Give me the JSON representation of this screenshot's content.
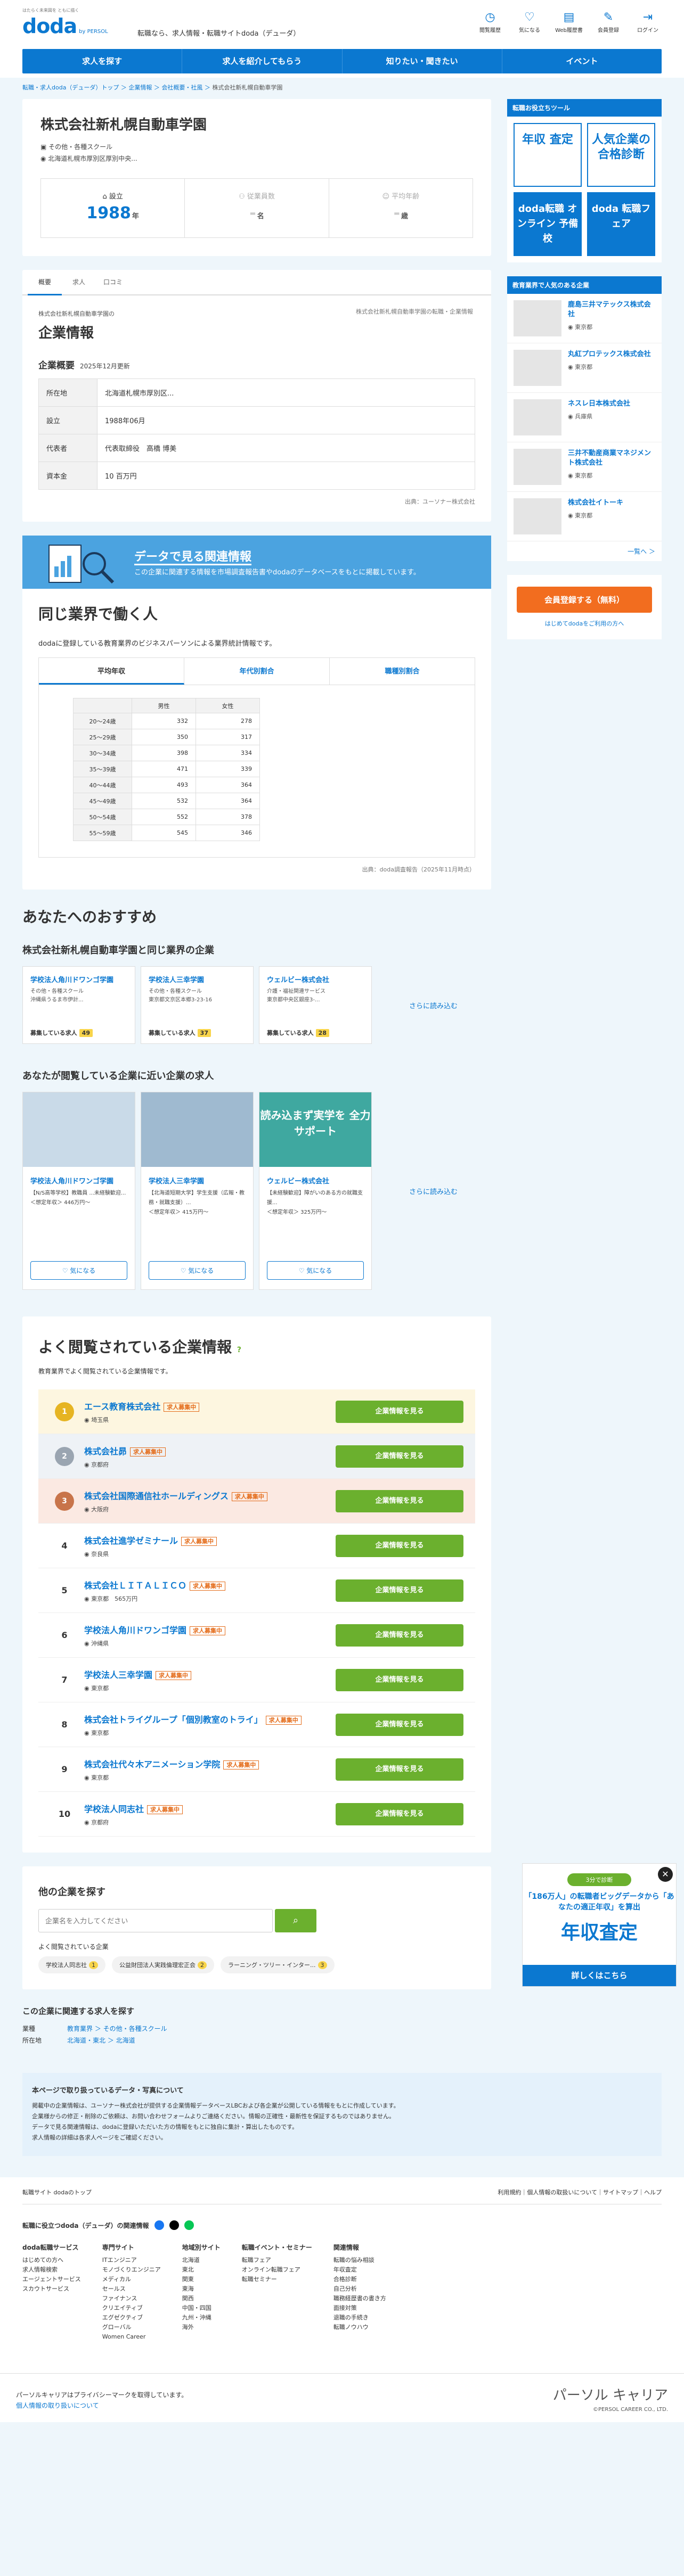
{
  "header": {
    "logo_small": "はたらく未来図を ともに描く",
    "logo_main": "doda",
    "logo_sub": "by PERSOL",
    "tagline": "転職なら、求人情報・転職サイトdoda（デューダ）",
    "icons": [
      {
        "label": "閲覧履歴",
        "icon": "clock-icon",
        "glyph": "◷"
      },
      {
        "label": "気になる",
        "icon": "heart-icon",
        "glyph": "♡"
      },
      {
        "label": "Web履歴書",
        "icon": "document-icon",
        "glyph": "▤"
      },
      {
        "label": "会員登録",
        "icon": "pencil-icon",
        "glyph": "✎"
      },
      {
        "label": "ログイン",
        "icon": "login-icon",
        "glyph": "⇥"
      }
    ]
  },
  "nav": [
    "求人を探す",
    "求人を紹介してもらう",
    "知りたい・聞きたい",
    "イベント"
  ],
  "breadcrumb": {
    "items": [
      "転職・求人doda（デューダ）トップ",
      "企業情報",
      "会社概要・社風"
    ],
    "current": "株式会社新札幌自動車学園"
  },
  "company": {
    "name": "株式会社新札幌自動車学園",
    "industry": "その他・各種スクール",
    "address": "北海道札幌市厚別区厚別中央...",
    "stats": [
      {
        "label": "設立",
        "value": "1988",
        "unit": "年",
        "dim": false
      },
      {
        "label": "従業員数",
        "value": "-",
        "unit": "名",
        "dim": true
      },
      {
        "label": "平均年齢",
        "value": "-",
        "unit": "歳",
        "dim": true
      }
    ]
  },
  "tabs": [
    "概要",
    "求人",
    "口コミ"
  ],
  "info": {
    "source_note": "株式会社新札幌自動車学園の転職・企業情報",
    "kana": "株式会社新札幌自動車学園の",
    "title": "企業情報",
    "section": "企業概要",
    "updated": "2025年12月更新",
    "rows": [
      {
        "th": "所在地",
        "td": "北海道札幌市厚別区..."
      },
      {
        "th": "設立",
        "td": "1988年06月"
      },
      {
        "th": "代表者",
        "td": "代表取締役　高橋 博美"
      },
      {
        "th": "資本金",
        "td": "10 百万円"
      }
    ],
    "footer": "出典：ユーソナー株式会社"
  },
  "data_banner": {
    "title": "データで見る関連情報",
    "sub": "この企業に関連する情報を市場調査報告書やdodaのデータベースをもとに掲載しています。"
  },
  "same_industry": {
    "title": "同じ業界で働く人",
    "desc": "dodaに登録している教育業界のビジネスパーソンによる業界統計情報です。",
    "tabs": [
      "平均年収",
      "年代別割合",
      "職種別割合"
    ],
    "table": {
      "headers": [
        "男性",
        "女性"
      ],
      "rows": [
        {
          "age": "20〜24歳",
          "m": "332",
          "f": "278"
        },
        {
          "age": "25〜29歳",
          "m": "350",
          "f": "317"
        },
        {
          "age": "30〜34歳",
          "m": "398",
          "f": "334"
        },
        {
          "age": "35〜39歳",
          "m": "471",
          "f": "339"
        },
        {
          "age": "40〜44歳",
          "m": "493",
          "f": "364"
        },
        {
          "age": "45〜49歳",
          "m": "532",
          "f": "364"
        },
        {
          "age": "50〜54歳",
          "m": "552",
          "f": "378"
        },
        {
          "age": "55〜59歳",
          "m": "545",
          "f": "346"
        }
      ]
    },
    "footer": "出典：doda調査報告（2025年11月時点）"
  },
  "recommend": {
    "title": "あなたへのおすすめ",
    "same_title": "株式会社新札幌自動車学園と同じ業界の企業",
    "companies": [
      {
        "name": "学校法人角川ドワンゴ学園",
        "cat": "その他・各種スクール",
        "addr": "沖縄県うるま市伊計...",
        "badge": "募集している求人",
        "count": "49"
      },
      {
        "name": "学校法人三幸学園",
        "cat": "その他・各種スクール",
        "addr": "東京都文京区本郷3-23-16",
        "badge": "募集している求人",
        "count": "37"
      },
      {
        "name": "ウェルビー株式会社",
        "cat": "介護・福祉関連サービス",
        "addr": "東京都中央区銀座3-...",
        "badge": "募集している求人",
        "count": "28"
      }
    ],
    "more": "さらに読み込む",
    "viewed_title": "あなたが閲覧している企業に近い企業の求人",
    "jobs": [
      {
        "name": "学校法人角川ドワンゴ学園",
        "desc": "【N/S高等学校】教職員 ...未経験歓迎...",
        "salary": "＜想定年収＞ 446万円〜",
        "art": ""
      },
      {
        "name": "学校法人三幸学園",
        "desc": "【北海道短期大学】学生支援（広報・教務・就職支援）...",
        "salary": "＜想定年収＞ 415万円〜",
        "art": ""
      },
      {
        "name": "ウェルビー株式会社",
        "desc": "【未経験歓迎】障がいのある方の就職支援...",
        "salary": "＜想定年収＞ 325万円〜",
        "art": "読み込まず実学を 全力 サポート"
      }
    ],
    "fav_label": "気になる"
  },
  "popular": {
    "title": "よく閲覧されている企業情報",
    "desc": "教育業界でよく閲覧されている企業情報です。",
    "badge": "求人募集中",
    "btn": "企業情報を見る",
    "rows": [
      {
        "rank": "1",
        "name": "エース教育株式会社",
        "loc": "埼玉県",
        "extra": ""
      },
      {
        "rank": "2",
        "name": "株式会社昴",
        "loc": "京都府",
        "extra": ""
      },
      {
        "rank": "3",
        "name": "株式会社国際通信社ホールディングス",
        "loc": "大阪府",
        "extra": ""
      },
      {
        "rank": "4",
        "name": "株式会社進学ゼミナール",
        "loc": "奈良県",
        "extra": ""
      },
      {
        "rank": "5",
        "name": "株式会社ＬＩＴＡＬＩＣＯ",
        "loc": "東京都",
        "extra": "565万円"
      },
      {
        "rank": "6",
        "name": "学校法人角川ドワンゴ学園",
        "loc": "沖縄県",
        "extra": ""
      },
      {
        "rank": "7",
        "name": "学校法人三幸学園",
        "loc": "東京都",
        "extra": ""
      },
      {
        "rank": "8",
        "name": "株式会社トライグループ「個別教室のトライ」",
        "loc": "東京都",
        "extra": ""
      },
      {
        "rank": "9",
        "name": "株式会社代々木アニメーション学院",
        "loc": "東京都",
        "extra": ""
      },
      {
        "rank": "10",
        "name": "学校法人同志社",
        "loc": "京都府",
        "extra": ""
      }
    ]
  },
  "search": {
    "title": "他の企業を探す",
    "placeholder": "企業名を入力してください",
    "often": "よく閲覧されている企業",
    "chips": [
      {
        "label": "学校法人同志社",
        "n": "1"
      },
      {
        "label": "公益財団法人実践倫理宏正会",
        "n": "2"
      },
      {
        "label": "ラーニング・ツリー・インター...",
        "n": "3"
      }
    ]
  },
  "find_more": {
    "title": "この企業に関連する求人を探す",
    "rows": [
      {
        "k": "業種",
        "links": "教育業界 ＞ その他・各種スクール"
      },
      {
        "k": "所在地",
        "links": "北海道・東北 ＞ 北海道"
      }
    ]
  },
  "notes": {
    "title": "本ページで取り扱っているデータ・写真について",
    "lines": [
      "掲載中の企業情報は、ユーソナー株式会社が提供する企業情報データベースLBCおよび各企業が公開している情報をもとに作成しています。",
      "企業様からの修正・削除のご依頼は、お問い合わせフォームよりご連絡ください。情報の正確性・最新性を保証するものではありません。",
      "データで見る関連情報は、dodaに登録いただいた方の情報をもとに独自に集計・算出したものです。",
      "求人情報の詳細は各求人ページをご確認ください。"
    ]
  },
  "footer": {
    "left": "転職サイト dodaのトップ",
    "right": "利用規約｜個人情報の取扱いについて｜サイトマップ｜ヘルプ",
    "social_title": "転職に役立つdoda（デューダ）の関連情報",
    "cols": [
      {
        "title": "doda転職サービス",
        "items": [
          "はじめての方へ",
          "求人情報検索",
          "エージェントサービス",
          "スカウトサービス"
        ]
      },
      {
        "title": "専門サイト",
        "items": [
          "ITエンジニア",
          "モノづくりエンジニア",
          "メディカル",
          "セールス",
          "ファイナンス",
          "クリエイティブ",
          "エグゼクティブ",
          "グローバル",
          "Women Career"
        ]
      },
      {
        "title": "地域別サイト",
        "items": [
          "北海道",
          "東北",
          "関東",
          "東海",
          "関西",
          "中国・四国",
          "九州・沖縄",
          "海外"
        ]
      },
      {
        "title": "転職イベント・セミナー",
        "items": [
          "転職フェア",
          "オンライン転職フェア",
          "転職セミナー"
        ]
      },
      {
        "title": "関連情報",
        "items": [
          "転職の悩み相談",
          "年収査定",
          "合格診断",
          "自己分析",
          "職務経歴書の書き方",
          "面接対策",
          "退職の手続き",
          "転職ノウハウ"
        ]
      }
    ],
    "copyright": "©PERSOL CAREER CO., LTD.",
    "bottom_text": "パーソルキャリアはプライバシーマークを取得しています。",
    "bottom_link": "個人情報の取り扱いについて",
    "brand": "パーソル キャリア"
  },
  "side": {
    "tools_title": "転職お役立ちツール",
    "tools": [
      {
        "label": "年収 査定",
        "blue": false
      },
      {
        "label": "人気企業の 合格診断",
        "blue": false
      },
      {
        "label": "doda転職 オンライン 予備校",
        "blue": true
      },
      {
        "label": "doda 転職フェア",
        "blue": true
      }
    ],
    "companies_title": "教育業界で人気のある企業",
    "companies": [
      {
        "name": "鹿島三井マテックス株式会社",
        "loc": "東京都"
      },
      {
        "name": "丸紅プロテックス株式会社",
        "loc": "東京都"
      },
      {
        "name": "ネスレ日本株式会社",
        "loc": "兵庫県"
      },
      {
        "name": "三井不動産商業マネジメント株式会社",
        "loc": "東京都"
      },
      {
        "name": "株式会社イトーキ",
        "loc": "東京都"
      }
    ],
    "more": "一覧へ ＞",
    "register": "会員登録する（無料）",
    "register_hint": "はじめてdodaをご利用の方へ"
  },
  "ad": {
    "q": "3分で診断",
    "p": "「186万人」の転職者ビッグデータから「あなたの適正年収」を算出",
    "big": "年収査定",
    "cta": "詳しくはこちら"
  }
}
